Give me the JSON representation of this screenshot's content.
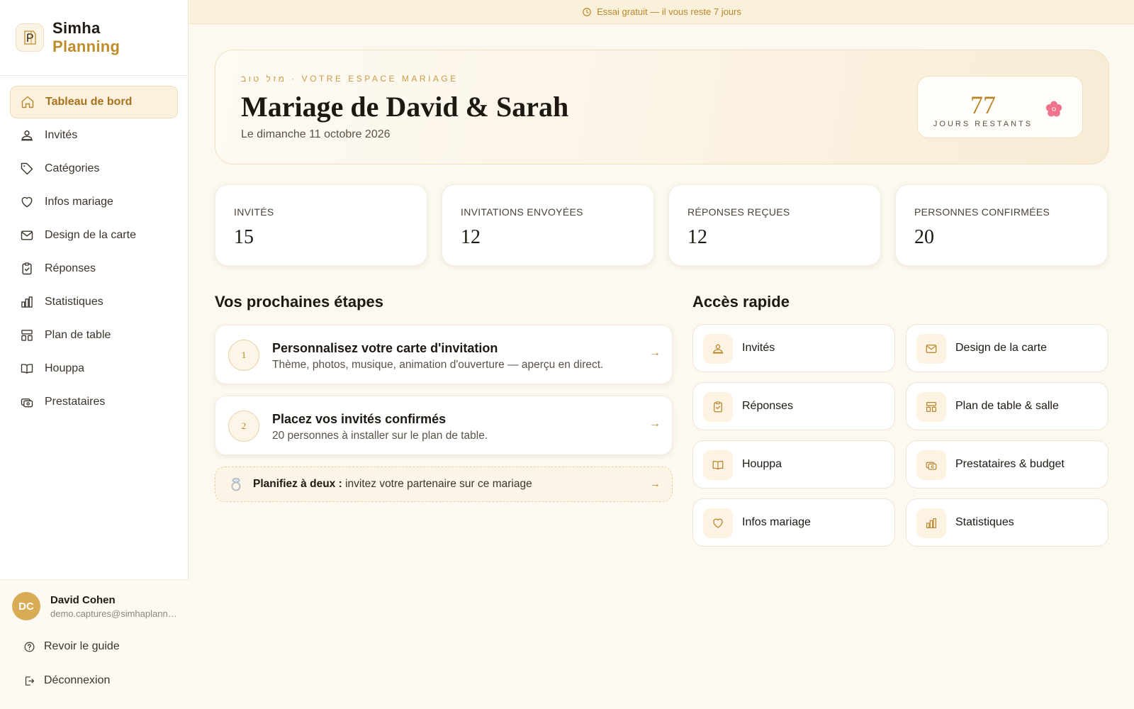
{
  "brand": {
    "name_1": "Simha",
    "name_2": "Planning"
  },
  "colors": {
    "accent": "#c08d2b",
    "accent_bg": "#fbf1de",
    "background": "#fdf9f1"
  },
  "sidebar": {
    "items": [
      {
        "label": "Tableau de bord",
        "icon": "home-icon",
        "active": true
      },
      {
        "label": "Invités",
        "icon": "guests-icon"
      },
      {
        "label": "Catégories",
        "icon": "tag-icon"
      },
      {
        "label": "Infos mariage",
        "icon": "heart-icon"
      },
      {
        "label": "Design de la carte",
        "icon": "mail-icon"
      },
      {
        "label": "Réponses",
        "icon": "clipboard-check-icon"
      },
      {
        "label": "Statistiques",
        "icon": "bar-chart-icon"
      },
      {
        "label": "Plan de table",
        "icon": "table-layout-icon"
      },
      {
        "label": "Houppa",
        "icon": "book-open-icon"
      },
      {
        "label": "Prestataires",
        "icon": "vendors-icon"
      }
    ],
    "user": {
      "initials": "DC",
      "name": "David Cohen",
      "email": "demo.captures@simhaplanning.com"
    },
    "guide_label": "Revoir le guide",
    "logout_label": "Déconnexion"
  },
  "trial": {
    "text": "Essai gratuit — il vous reste 7 jours"
  },
  "hero": {
    "eyebrow": "מזל טוב · VOTRE ESPACE MARIAGE",
    "title": "Mariage de David & Sarah",
    "date": "Le dimanche 11 octobre 2026",
    "countdown_value": "77",
    "countdown_label": "JOURS RESTANTS"
  },
  "stats": [
    {
      "label": "INVITÉS",
      "value": "15"
    },
    {
      "label": "INVITATIONS ENVOYÉES",
      "value": "12"
    },
    {
      "label": "RÉPONSES REÇUES",
      "value": "12"
    },
    {
      "label": "PERSONNES CONFIRMÉES",
      "value": "20"
    }
  ],
  "next_steps": {
    "title": "Vos prochaines étapes",
    "steps": [
      {
        "number": "1",
        "title": "Personnalisez votre carte d'invitation",
        "description": "Thème, photos, musique, animation d'ouverture — aperçu en direct."
      },
      {
        "number": "2",
        "title": "Placez vos invités confirmés",
        "description": "20 personnes à installer sur le plan de table."
      }
    ],
    "partner": {
      "bold": "Planifiez à deux :",
      "text": " invitez votre partenaire sur ce mariage"
    },
    "arrow": "→"
  },
  "quick_access": {
    "title": "Accès rapide",
    "items": [
      {
        "label": "Invités",
        "icon": "guests-icon"
      },
      {
        "label": "Design de la carte",
        "icon": "mail-icon"
      },
      {
        "label": "Réponses",
        "icon": "clipboard-check-icon"
      },
      {
        "label": "Plan de table & salle",
        "icon": "table-layout-icon"
      },
      {
        "label": "Houppa",
        "icon": "book-open-icon"
      },
      {
        "label": "Prestataires & budget",
        "icon": "vendors-icon"
      },
      {
        "label": "Infos mariage",
        "icon": "heart-icon"
      },
      {
        "label": "Statistiques",
        "icon": "bar-chart-icon"
      }
    ]
  }
}
